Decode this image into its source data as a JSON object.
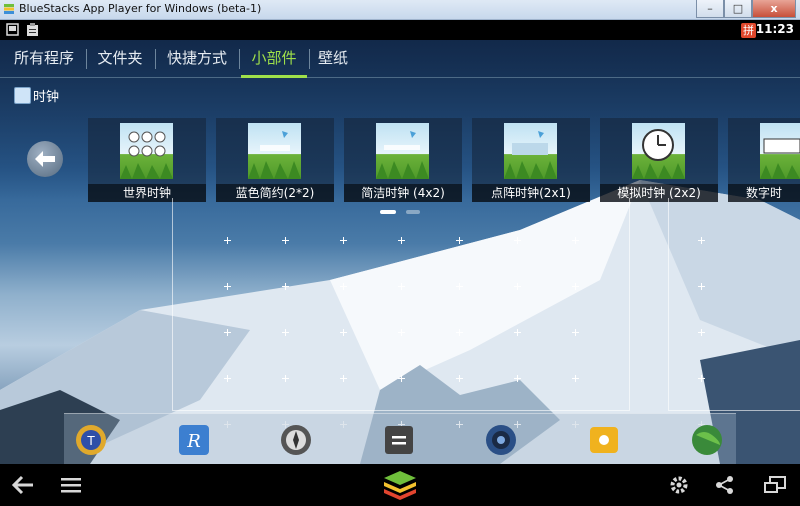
{
  "window": {
    "title": "BlueStacks App Player for Windows (beta-1)",
    "minimize_label": "–",
    "maximize_label": "□",
    "close_label": "x"
  },
  "statusbar": {
    "ime_label": "拼",
    "time": "11:23"
  },
  "tabs": [
    {
      "label": "所有程序",
      "active": false
    },
    {
      "label": "文件夹",
      "active": false
    },
    {
      "label": "快捷方式",
      "active": false
    },
    {
      "label": "小部件",
      "active": true
    },
    {
      "label": "壁纸",
      "active": false
    }
  ],
  "category": {
    "label": "时钟"
  },
  "widgets": [
    {
      "label": "世界时钟"
    },
    {
      "label": "蓝色简约(2*2)"
    },
    {
      "label": "简洁时钟 (4x2)"
    },
    {
      "label": "点阵时钟(2x1)"
    },
    {
      "label": "模拟时钟 (2x2)"
    },
    {
      "label": "数字时"
    }
  ],
  "pager": {
    "pages": 2,
    "current": 1
  },
  "dock": {
    "icons": [
      "titanium-backup-icon",
      "reader-icon",
      "compass-icon",
      "calculator-icon",
      "speaker-icon",
      "folder-icon",
      "globe-icon"
    ]
  },
  "colors": {
    "accent": "#9fe04a",
    "close_button": "#c7503a"
  }
}
